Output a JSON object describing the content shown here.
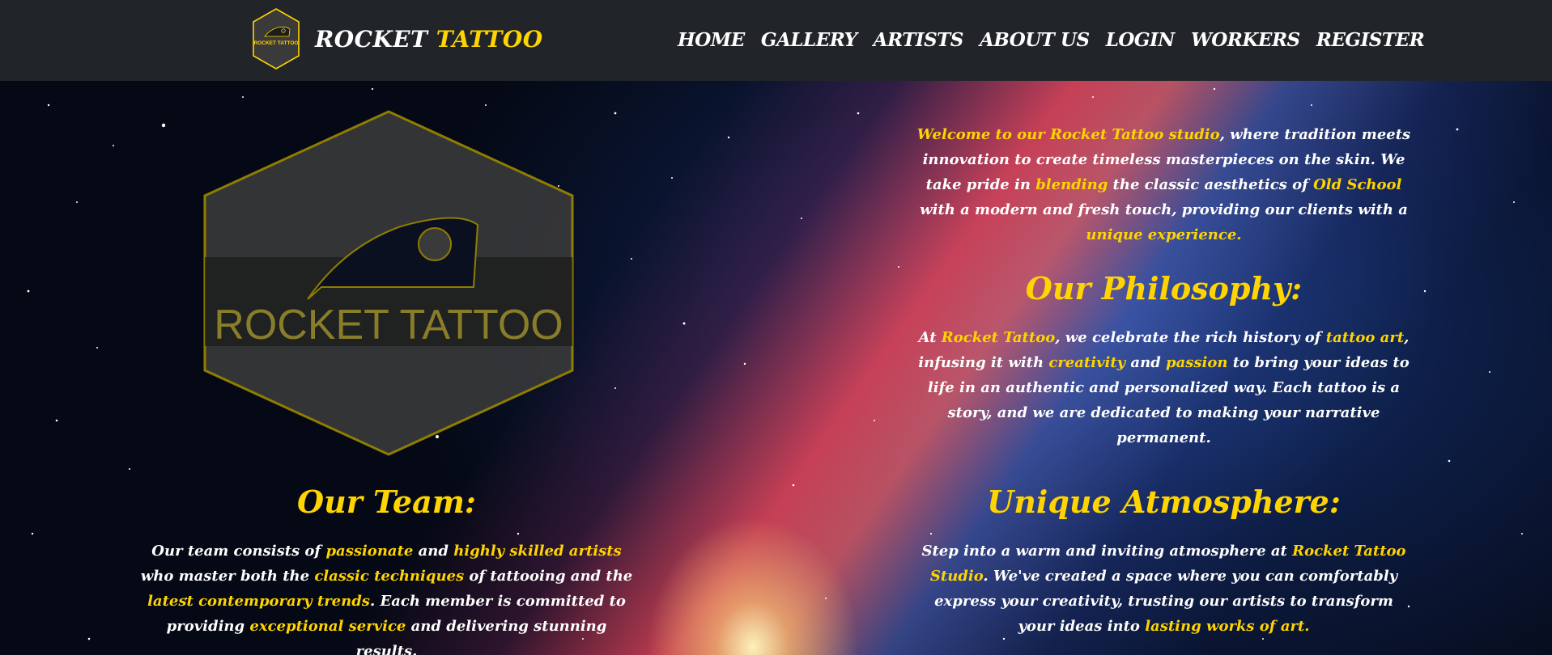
{
  "brand": {
    "name_white": "ROCKET",
    "name_yellow": "TATTOO",
    "logo_text": "ROCKET TATTOO"
  },
  "nav": [
    "HOME",
    "GALLERY",
    "ARTISTS",
    "ABOUT US",
    "LOGIN",
    "WORKERS",
    "REGISTER"
  ],
  "colors": {
    "accent": "#ffd400",
    "navbar_bg": "#212529",
    "text": "#ffffff",
    "logo_fill": "#3a3a3a"
  },
  "intro": {
    "segments": [
      {
        "text": "Welcome to our Rocket Tattoo studio",
        "hl": true
      },
      {
        "text": ", where tradition meets innovation to create timeless masterpieces on the skin. We take pride in ",
        "hl": false
      },
      {
        "text": "blending",
        "hl": true
      },
      {
        "text": " the classic aesthetics of ",
        "hl": false
      },
      {
        "text": "Old School",
        "hl": true
      },
      {
        "text": " with a modern and fresh touch, providing our clients with a ",
        "hl": false
      },
      {
        "text": "unique experience.",
        "hl": true
      }
    ]
  },
  "philosophy": {
    "title": "Our Philosophy:",
    "segments": [
      {
        "text": "At ",
        "hl": false
      },
      {
        "text": "Rocket Tattoo",
        "hl": true
      },
      {
        "text": ", we celebrate the rich history of ",
        "hl": false
      },
      {
        "text": "tattoo art",
        "hl": true
      },
      {
        "text": ", infusing it with ",
        "hl": false
      },
      {
        "text": "creativity",
        "hl": true
      },
      {
        "text": " and ",
        "hl": false
      },
      {
        "text": "passion",
        "hl": true
      },
      {
        "text": " to bring your ideas to life in an authentic and personalized way. Each tattoo is a story, and we are dedicated to making your narrative permanent.",
        "hl": false
      }
    ]
  },
  "team": {
    "title": "Our Team:",
    "segments": [
      {
        "text": "Our team consists of ",
        "hl": false
      },
      {
        "text": "passionate",
        "hl": true
      },
      {
        "text": " and ",
        "hl": false
      },
      {
        "text": "highly skilled artists",
        "hl": true
      },
      {
        "text": " who master both the ",
        "hl": false
      },
      {
        "text": "classic techniques",
        "hl": true
      },
      {
        "text": " of tattooing and the ",
        "hl": false
      },
      {
        "text": "latest contemporary trends",
        "hl": true
      },
      {
        "text": ". Each member is committed to providing ",
        "hl": false
      },
      {
        "text": "exceptional service",
        "hl": true
      },
      {
        "text": " and delivering stunning results.",
        "hl": false
      }
    ]
  },
  "atmosphere": {
    "title": "Unique Atmosphere:",
    "segments": [
      {
        "text": "Step into a warm and inviting atmosphere at ",
        "hl": false
      },
      {
        "text": "Rocket Tattoo Studio",
        "hl": true
      },
      {
        "text": ". We've created a space where you can comfortably express your creativity, trusting our artists to transform your ideas into ",
        "hl": false
      },
      {
        "text": "lasting works of art.",
        "hl": true
      }
    ]
  }
}
